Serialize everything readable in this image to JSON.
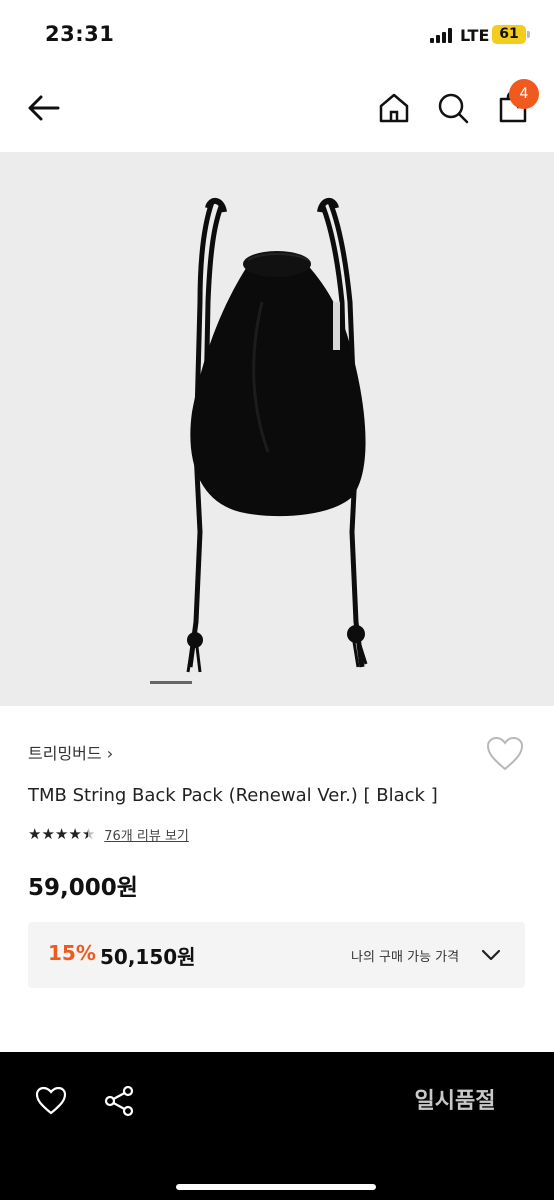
{
  "status_bar": {
    "time": "23:31",
    "network": "LTE",
    "battery": "61"
  },
  "nav": {
    "cart_count": "4"
  },
  "product": {
    "brand": "트리밍버드",
    "brand_chevron": "›",
    "name": "TMB String Back Pack (Renewal Ver.) [ Black ]",
    "rating_stars": 4.5,
    "review_text": "76개 리뷰 보기",
    "original_price": "59,000원",
    "discount_rate": "15%",
    "sale_price": "50,150원",
    "my_price_label": "나의 구매 가능 가격"
  },
  "gallery": {
    "slide_index": 1
  },
  "bottom_bar": {
    "cta_label": "일시품절"
  },
  "colors": {
    "accent": "#f05a1e",
    "battery": "#f3cc1d",
    "image_bg": "#ececec"
  }
}
